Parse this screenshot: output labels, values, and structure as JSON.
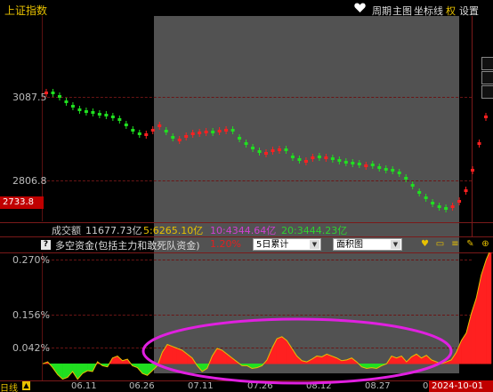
{
  "window": {
    "title": "上证指数"
  },
  "toolbar": {
    "items": [
      "周期",
      "主图",
      "坐标线",
      "权",
      "设置"
    ],
    "active_index": 3
  },
  "price_axis": {
    "labels": [
      "3087.5",
      "2806.8"
    ],
    "current_price": "2733.8"
  },
  "volume_row": {
    "label": "成交额",
    "total": "11677.73亿",
    "ma5": "5:6265.10亿",
    "ma10": "10:4344.64亿",
    "ma20": "20:3444.23亿",
    "colors": {
      "label": "#cccccc",
      "ma5": "#e8c100",
      "ma10": "#d040d0",
      "ma20": "#30d030"
    }
  },
  "indicator": {
    "help_icon": "?",
    "title": "多空资金(包括主力和敢死队资金)",
    "value": "1.20%",
    "period_select": "5日累计",
    "chart_select": "面积图",
    "y_labels": [
      "0.270%",
      "0.156%",
      "0.042%"
    ]
  },
  "x_axis": {
    "period_label": "日线",
    "dates": [
      "06.11",
      "06.26",
      "07.11",
      "07.26",
      "08.12",
      "08.27",
      "0"
    ],
    "current_date": "2024-10-01"
  },
  "colors": {
    "up": "#ff2020",
    "down": "#20e020",
    "highlight_ellipse": "#e020e0",
    "shade": "#525252"
  },
  "icons": {
    "toolbar": "heart-icon",
    "indicator_toolbar": [
      "heart-icon",
      "window-icon",
      "stack-icon",
      "wrench-icon",
      "zoom-icon"
    ]
  },
  "chart_data": {
    "type": "area",
    "series": [
      {
        "values": [
          0.0,
          0.005,
          -0.01,
          -0.028,
          -0.04,
          -0.035,
          -0.02,
          -0.04,
          -0.025,
          -0.018,
          -0.02,
          0.005,
          -0.005,
          -0.008,
          0.015,
          0.02,
          0.008,
          0.012,
          -0.005,
          -0.01,
          -0.025,
          -0.03,
          -0.018,
          -0.005,
          0.03,
          0.05,
          0.045,
          0.04,
          0.035,
          0.025,
          0.015,
          -0.005,
          -0.02,
          -0.012,
          0.02,
          0.04,
          0.035,
          0.025,
          0.015,
          0.005,
          -0.005,
          -0.005,
          -0.012,
          -0.01,
          -0.005,
          0.01,
          0.04,
          0.065,
          0.07,
          0.06,
          0.04,
          0.02,
          0.008,
          0.005,
          0.012,
          0.02,
          0.018,
          0.025,
          0.02,
          0.015,
          0.008,
          0.01,
          0.015,
          0.005,
          -0.008,
          -0.012,
          -0.01,
          -0.012,
          -0.005,
          0.0,
          0.02,
          0.015,
          0.02,
          0.005,
          0.018,
          0.025,
          0.015,
          0.022,
          0.01,
          0.005,
          0.0,
          0.005,
          0.01,
          0.03,
          0.06,
          0.08,
          0.13,
          0.17,
          0.23,
          0.27,
          0.3
        ]
      }
    ]
  }
}
